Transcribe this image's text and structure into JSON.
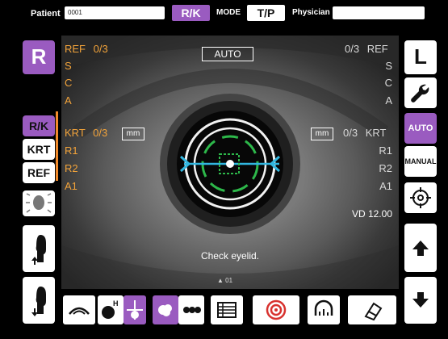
{
  "top_bar": {
    "patient_label": "Patient",
    "patient_value": "0001",
    "rk_button": "R/K",
    "mode_label": "MODE",
    "tp_button": "T/P",
    "physician_label": "Physician",
    "physician_value": ""
  },
  "eye_side_left": "R",
  "eye_side_right": "L",
  "view": {
    "auto_badge": "AUTO",
    "ref_left": {
      "label": "REF",
      "count": "0/3",
      "rows": [
        "S",
        "C",
        "A"
      ]
    },
    "ref_right": {
      "label": "REF",
      "count": "0/3",
      "rows": [
        "S",
        "C",
        "A"
      ]
    },
    "krt_left": {
      "label": "KRT",
      "count": "0/3",
      "unit": "mm",
      "rows": [
        "R1",
        "R2",
        "A1"
      ]
    },
    "krt_right": {
      "label": "KRT",
      "count": "0/3",
      "unit": "mm",
      "rows": [
        "R1",
        "R2",
        "A1"
      ]
    },
    "vd": "VD 12.00",
    "message": "Check eyelid.",
    "counter": "01"
  },
  "left_panel": {
    "mode_buttons": [
      "R/K",
      "KRT",
      "REF"
    ],
    "active_mode": "R/K"
  },
  "right_panel": {
    "auto_label": "AUTO",
    "manual_label": "MANUAL"
  },
  "colors": {
    "accent": "#9a5bc0",
    "reading": "#f2a33a",
    "reticle": "#2db84a",
    "crosshair": "#31b6e0"
  }
}
